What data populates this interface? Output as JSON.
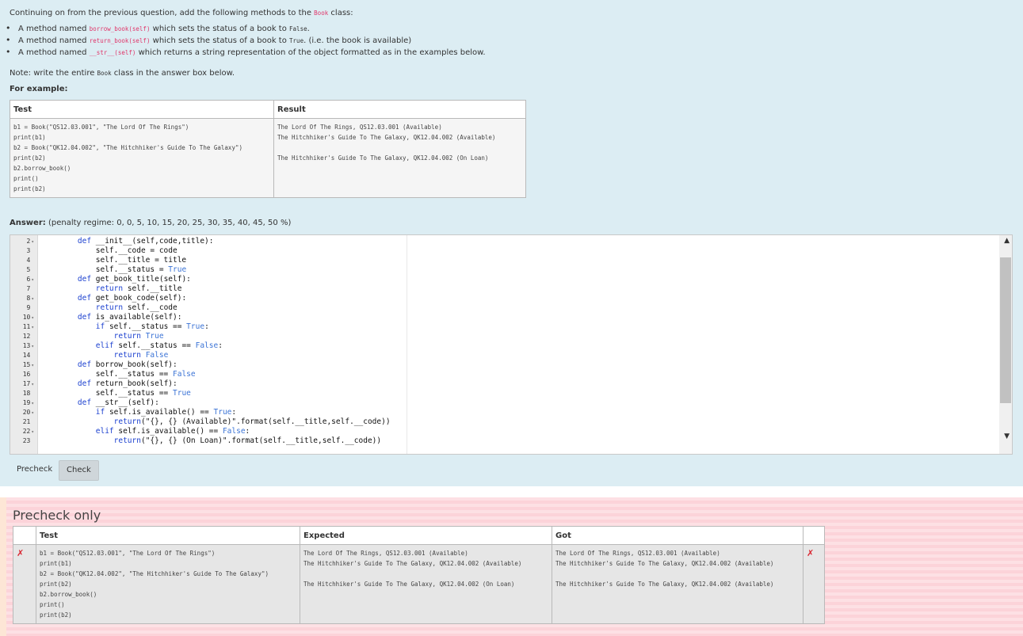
{
  "question": {
    "intro_prefix": "Continuing on from the previous question, add the following methods to the ",
    "intro_code": "Book",
    "intro_suffix": " class:",
    "bullets": [
      {
        "prefix": "A method named ",
        "code": "borrow_book(self)",
        "suffix": " which sets the status of a book to ",
        "code2": "False",
        "end": "."
      },
      {
        "prefix": "A method named ",
        "code": "return_book(self)",
        "suffix": " which sets the status of a book to ",
        "code2": "True",
        "end": ". (i.e. the book is available)"
      },
      {
        "prefix": "A method named ",
        "code": "__str__(self)",
        "suffix": " which returns a string representation of the object formatted as in the examples below.",
        "code2": "",
        "end": ""
      }
    ],
    "note_prefix": "Note: write the entire ",
    "note_code": "Book",
    "note_suffix": " class in the answer box below.",
    "for_example": "For example:"
  },
  "example_table": {
    "headers": [
      "Test",
      "Result"
    ],
    "test": "b1 = Book(\"QS12.03.001\", \"The Lord Of The Rings\")\nprint(b1)\nb2 = Book(\"QK12.04.002\", \"The Hitchhiker's Guide To The Galaxy\")\nprint(b2)\nb2.borrow_book()\nprint()\nprint(b2)",
    "result": "The Lord Of The Rings, QS12.03.001 (Available)\nThe Hitchhiker's Guide To The Galaxy, QK12.04.002 (Available)\n\nThe Hitchhiker's Guide To The Galaxy, QK12.04.002 (On Loan)"
  },
  "answer": {
    "label": "Answer:",
    "penalty": "(penalty regime: 0, 0, 5, 10, 15, 20, 25, 30, 35, 40, 45, 50 %)"
  },
  "editor": {
    "lines": [
      {
        "n": "2",
        "fold": true,
        "segs": [
          {
            "t": "    "
          },
          {
            "t": "def",
            "c": "kw"
          },
          {
            "t": " __init__(self,code,title):"
          }
        ]
      },
      {
        "n": "3",
        "fold": false,
        "segs": [
          {
            "t": "        self.__code = code"
          }
        ]
      },
      {
        "n": "4",
        "fold": false,
        "segs": [
          {
            "t": "        self.__title = title"
          }
        ]
      },
      {
        "n": "5",
        "fold": false,
        "segs": [
          {
            "t": "        self.__status = "
          },
          {
            "t": "True",
            "c": "bl"
          }
        ]
      },
      {
        "n": "6",
        "fold": true,
        "segs": [
          {
            "t": "    "
          },
          {
            "t": "def",
            "c": "kw"
          },
          {
            "t": " get_book_title(self):"
          }
        ]
      },
      {
        "n": "7",
        "fold": false,
        "segs": [
          {
            "t": "        "
          },
          {
            "t": "return",
            "c": "kw"
          },
          {
            "t": " self.__title"
          }
        ]
      },
      {
        "n": "8",
        "fold": true,
        "segs": [
          {
            "t": "    "
          },
          {
            "t": "def",
            "c": "kw"
          },
          {
            "t": " get_book_code(self):"
          }
        ]
      },
      {
        "n": "9",
        "fold": false,
        "segs": [
          {
            "t": "        "
          },
          {
            "t": "return",
            "c": "kw"
          },
          {
            "t": " self.__code"
          }
        ]
      },
      {
        "n": "10",
        "fold": true,
        "segs": [
          {
            "t": "    "
          },
          {
            "t": "def",
            "c": "kw"
          },
          {
            "t": " is_available(self):"
          }
        ]
      },
      {
        "n": "11",
        "fold": true,
        "segs": [
          {
            "t": "        "
          },
          {
            "t": "if",
            "c": "kw"
          },
          {
            "t": " self.__status == "
          },
          {
            "t": "True",
            "c": "bl"
          },
          {
            "t": ":"
          }
        ]
      },
      {
        "n": "12",
        "fold": false,
        "segs": [
          {
            "t": "            "
          },
          {
            "t": "return",
            "c": "kw"
          },
          {
            "t": " "
          },
          {
            "t": "True",
            "c": "bl"
          }
        ]
      },
      {
        "n": "13",
        "fold": true,
        "segs": [
          {
            "t": "        "
          },
          {
            "t": "elif",
            "c": "kw"
          },
          {
            "t": " self.__status == "
          },
          {
            "t": "False",
            "c": "bl"
          },
          {
            "t": ":"
          }
        ]
      },
      {
        "n": "14",
        "fold": false,
        "segs": [
          {
            "t": "            "
          },
          {
            "t": "return",
            "c": "kw"
          },
          {
            "t": " "
          },
          {
            "t": "False",
            "c": "bl"
          }
        ]
      },
      {
        "n": "15",
        "fold": true,
        "segs": [
          {
            "t": "    "
          },
          {
            "t": "def",
            "c": "kw"
          },
          {
            "t": " borrow_book(self):"
          }
        ]
      },
      {
        "n": "16",
        "fold": false,
        "segs": [
          {
            "t": "        self.__status == "
          },
          {
            "t": "False",
            "c": "bl"
          }
        ]
      },
      {
        "n": "17",
        "fold": true,
        "segs": [
          {
            "t": "    "
          },
          {
            "t": "def",
            "c": "kw"
          },
          {
            "t": " return_book(self):"
          }
        ]
      },
      {
        "n": "18",
        "fold": false,
        "segs": [
          {
            "t": "        self.__status == "
          },
          {
            "t": "True",
            "c": "bl"
          }
        ]
      },
      {
        "n": "19",
        "fold": true,
        "segs": [
          {
            "t": "    "
          },
          {
            "t": "def",
            "c": "kw"
          },
          {
            "t": " __str__(self):"
          }
        ]
      },
      {
        "n": "20",
        "fold": true,
        "segs": [
          {
            "t": "        "
          },
          {
            "t": "if",
            "c": "kw"
          },
          {
            "t": " self.is_available() == "
          },
          {
            "t": "True",
            "c": "bl"
          },
          {
            "t": ":"
          }
        ]
      },
      {
        "n": "21",
        "fold": false,
        "segs": [
          {
            "t": "            "
          },
          {
            "t": "return",
            "c": "kw"
          },
          {
            "t": "(\"{}, {} (Available)\".format(self.__title,self.__code))"
          }
        ]
      },
      {
        "n": "22",
        "fold": true,
        "segs": [
          {
            "t": "        "
          },
          {
            "t": "elif",
            "c": "kw"
          },
          {
            "t": " self.is_available() == "
          },
          {
            "t": "False",
            "c": "bl"
          },
          {
            "t": ":"
          }
        ]
      },
      {
        "n": "23",
        "fold": false,
        "segs": [
          {
            "t": "            "
          },
          {
            "t": "return",
            "c": "kw"
          },
          {
            "t": "(\"{}, {} (On Loan)\".format(self.__title,self.__code))"
          }
        ]
      }
    ]
  },
  "buttons": {
    "precheck": "Precheck",
    "check": "Check"
  },
  "results": {
    "title": "Precheck only",
    "headers": [
      "Test",
      "Expected",
      "Got"
    ],
    "row": {
      "mark_left": "✗",
      "test": "b1 = Book(\"QS12.03.001\", \"The Lord Of The Rings\")\nprint(b1)\nb2 = Book(\"QK12.04.002\", \"The Hitchhiker's Guide To The Galaxy\")\nprint(b2)\nb2.borrow_book()\nprint()\nprint(b2)",
      "expected": "The Lord Of The Rings, QS12.03.001 (Available)\nThe Hitchhiker's Guide To The Galaxy, QK12.04.002 (Available)\n\nThe Hitchhiker's Guide To The Galaxy, QK12.04.002 (On Loan)",
      "got": "The Lord Of The Rings, QS12.03.001 (Available)\nThe Hitchhiker's Guide To The Galaxy, QK12.04.002 (Available)\n\nThe Hitchhiker's Guide To The Galaxy, QK12.04.002 (Available)",
      "mark_right": "✗"
    }
  },
  "colors": {
    "question_bg": "#dcedf3",
    "inline_code": "#e0366a",
    "keyword": "#1a3fcf",
    "fail_mark": "#d9232e"
  }
}
